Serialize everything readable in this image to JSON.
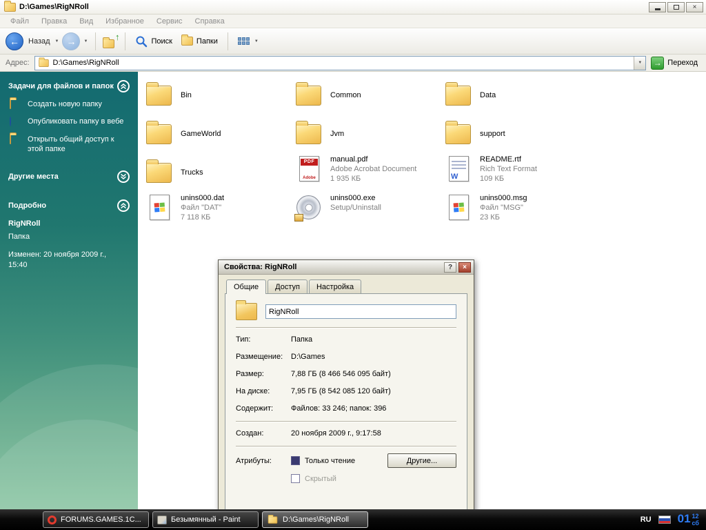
{
  "window": {
    "title": "D:\\Games\\RigNRoll",
    "menu": [
      "Файл",
      "Правка",
      "Вид",
      "Избранное",
      "Сервис",
      "Справка"
    ],
    "toolbar": {
      "back": "Назад",
      "search": "Поиск",
      "folders": "Папки"
    },
    "address": {
      "label": "Адрес:",
      "value": "D:\\Games\\RigNRoll",
      "go": "Переход"
    }
  },
  "sidebar": {
    "tasks": {
      "title": "Задачи для файлов и папок",
      "items": [
        "Создать новую папку",
        "Опубликовать папку в вебе",
        "Открыть общий доступ к этой папке"
      ]
    },
    "other_places": {
      "title": "Другие места"
    },
    "details": {
      "title": "Подробно",
      "name": "RigNRoll",
      "type": "Папка",
      "modified1": "Изменен: 20 ноября 2009 г.,",
      "modified2": "15:40"
    }
  },
  "files": [
    {
      "name": "Bin"
    },
    {
      "name": "Common"
    },
    {
      "name": "Data"
    },
    {
      "name": "GameWorld"
    },
    {
      "name": "Jvm"
    },
    {
      "name": "support"
    },
    {
      "name": "Trucks"
    },
    {
      "name": "manual.pdf",
      "line2": "Adobe Acrobat Document",
      "line3": "1 935 КБ"
    },
    {
      "name": "README.rtf",
      "line2": "Rich Text Format",
      "line3": "109 КБ"
    },
    {
      "name": "unins000.dat",
      "line2": "Файл \"DAT\"",
      "line3": "7 118 КБ"
    },
    {
      "name": "unins000.exe",
      "line2": "Setup/Uninstall"
    },
    {
      "name": "unins000.msg",
      "line2": "Файл \"MSG\"",
      "line3": "23 КБ"
    }
  ],
  "dialog": {
    "title": "Свойства: RigNRoll",
    "tabs": [
      "Общие",
      "Доступ",
      "Настройка"
    ],
    "name_value": "RigNRoll",
    "rows": [
      {
        "label": "Тип:",
        "value": "Папка"
      },
      {
        "label": "Размещение:",
        "value": "D:\\Games"
      },
      {
        "label": "Размер:",
        "value": "7,88 ГБ (8 466 546 095 байт)"
      },
      {
        "label": "На диске:",
        "value": "7,95 ГБ (8 542 085 120 байт)"
      },
      {
        "label": "Содержит:",
        "value": "Файлов: 33 246; папок: 396"
      }
    ],
    "created": {
      "label": "Создан:",
      "value": "20 ноября 2009 г., 9:17:58"
    },
    "attributes": {
      "label": "Атрибуты:",
      "readonly": "Только чтение",
      "hidden": "Скрытый",
      "other": "Другие..."
    }
  },
  "taskbar": {
    "items": [
      {
        "label": "FORUMS.GAMES.1C..."
      },
      {
        "label": "Безымянный - Paint"
      },
      {
        "label": "D:\\Games\\RigNRoll"
      }
    ],
    "tray": {
      "lang": "RU",
      "hour": "01",
      "minute": "12",
      "day": "сб"
    }
  },
  "icons": {
    "pdf_label": "PDF",
    "adobe_label": "Adobe",
    "rtf_letter": "W"
  },
  "glyphs": {
    "close": "×",
    "help": "?",
    "caret": "▼",
    "back": "←",
    "forward": "→",
    "up": "↑",
    "go": "→"
  },
  "colors": {
    "accent_blue": "#2f7df6",
    "sidebar_top": "#136a70",
    "sidebar_bottom": "#82c19c",
    "taskbar_bg": "#000000",
    "folder_yellow": "#f2c65e"
  }
}
